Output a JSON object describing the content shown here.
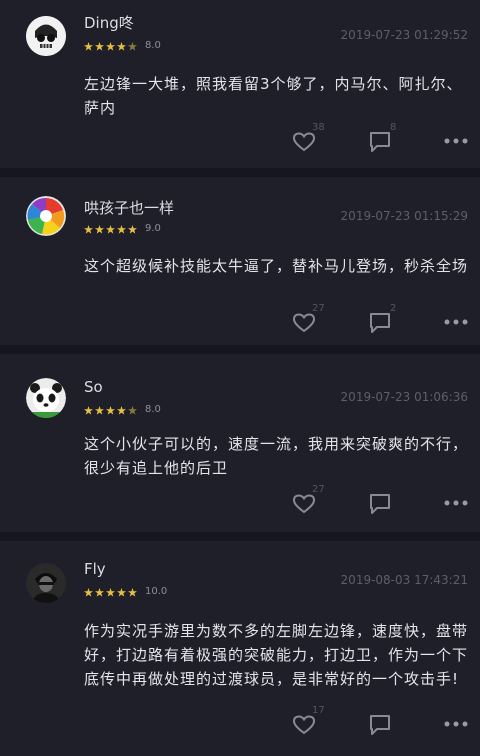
{
  "comments": [
    {
      "username": "Ding咚",
      "score": "8.0",
      "stars": 4,
      "timestamp": "2019-07-23 01:29:52",
      "text": "左边锋一大堆，照我看留3个够了，内马尔、阿扎尔、萨内",
      "likes": "38",
      "replies": "8",
      "avatar": "skull-avatar"
    },
    {
      "username": "哄孩子也一样",
      "score": "9.0",
      "stars": 5,
      "timestamp": "2019-07-23 01:15:29",
      "text": "这个超级候补技能太牛逼了，替补马儿登场，秒杀全场",
      "likes": "27",
      "replies": "2",
      "avatar": "colorful-swirl-avatar"
    },
    {
      "username": "So",
      "score": "8.0",
      "stars": 4,
      "timestamp": "2019-07-23 01:06:36",
      "text": "这个小伙子可以的，速度一流，我用来突破爽的不行，很少有追上他的后卫",
      "likes": "27",
      "replies": "",
      "avatar": "panda-avatar"
    },
    {
      "username": "Fly",
      "score": "10.0",
      "stars": 5,
      "timestamp": "2019-08-03 17:43:21",
      "text": "作为实况手游里为数不多的左脚左边锋，速度快，盘带好，打边路有着极强的突破能力，打边卫，作为一个下底传中再做处理的过渡球员，是非常好的一个攻击手!",
      "likes": "17",
      "replies": "",
      "avatar": "dark-portrait-avatar"
    }
  ],
  "colors": {
    "background": "#1f1f2a",
    "divider": "#161620",
    "star": "#e8c040",
    "icon": "#8a8a96"
  }
}
